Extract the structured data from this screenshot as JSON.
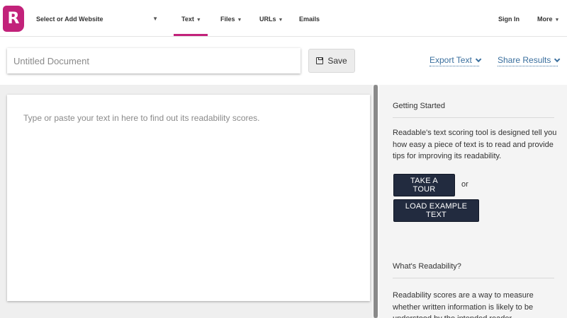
{
  "nav": {
    "logo_letter": "R",
    "site_select": "Select or Add Website",
    "items": [
      {
        "label": "Text",
        "has_caret": true,
        "active": true
      },
      {
        "label": "Files",
        "has_caret": true
      },
      {
        "label": "URLs",
        "has_caret": true
      },
      {
        "label": "Emails",
        "has_caret": false
      }
    ],
    "sign_in": "Sign In",
    "more": "More"
  },
  "toolbar": {
    "title_placeholder": "Untitled Document",
    "title_value": "",
    "save_label": "Save",
    "export_label": "Export Text",
    "share_label": "Share Results"
  },
  "editor": {
    "placeholder": "Type or paste your text in here to find out its readability scores.",
    "value": ""
  },
  "sidebar": {
    "getting_started": {
      "heading": "Getting Started",
      "text": "Readable's text scoring tool is designed tell you how easy a piece of text is to read and provide tips for improving its readability.",
      "tour_button": "TAKE A TOUR",
      "or": "or",
      "example_button": "LOAD EXAMPLE TEXT"
    },
    "whats_readability": {
      "heading": "What's Readability?",
      "text": "Readability scores are a way to measure whether written information is likely to be understood by the intended reader."
    }
  },
  "colors": {
    "brand": "#c2227a",
    "link": "#3a6f9e",
    "dark_button": "#222b3f"
  },
  "icons": {
    "save": "floppy-disk-icon",
    "dropdown": "chevron-down-icon",
    "caret": "caret-down-icon"
  }
}
